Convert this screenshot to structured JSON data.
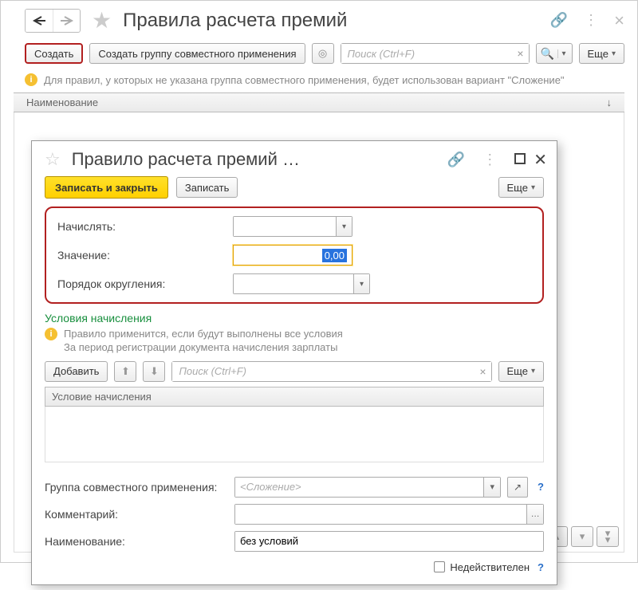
{
  "main": {
    "title": "Правила расчета премий",
    "toolbar": {
      "create": "Создать",
      "create_group": "Создать группу совместного применения",
      "search_placeholder": "Поиск (Ctrl+F)",
      "more": "Еще"
    },
    "info": "Для правил, у которых не указана группа совместного применения, будет использован вариант \"Сложение\"",
    "list_header": "Наименование"
  },
  "modal": {
    "title": "Правило расчета премий …",
    "toolbar": {
      "save_close": "Записать и закрыть",
      "save": "Записать",
      "more": "Еще"
    },
    "form": {
      "accrue_label": "Начислять:",
      "accrue_value": "",
      "value_label": "Значение:",
      "value_value": "0,00",
      "rounding_label": "Порядок округления:",
      "rounding_value": ""
    },
    "conditions": {
      "title": "Условия начисления",
      "info_line1": "Правило применится, если будут выполнены все условия",
      "info_line2": "За период регистрации документа начисления зарплаты",
      "add": "Добавить",
      "search_placeholder": "Поиск (Ctrl+F)",
      "more": "Еще",
      "header": "Условие начисления"
    },
    "fields": {
      "group_label": "Группа совместного применения:",
      "group_placeholder": "<Сложение>",
      "comment_label": "Комментарий:",
      "comment_value": "",
      "name_label": "Наименование:",
      "name_value": "без условий",
      "inactive_label": "Недействителен"
    }
  }
}
